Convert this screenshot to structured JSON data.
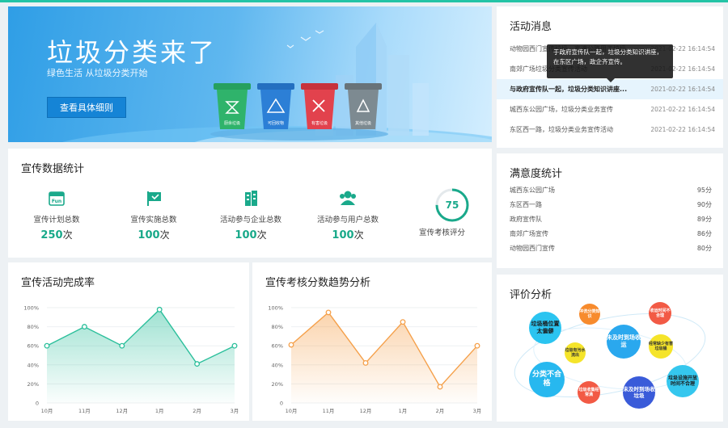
{
  "banner": {
    "headline": "垃圾分类来了",
    "sub": "绿色生活 从垃圾分类开始",
    "button": "查看具体细则",
    "bins": [
      {
        "label": "厨余垃圾",
        "color": "#2fb36b"
      },
      {
        "label": "可回收物",
        "color": "#2c7fd6"
      },
      {
        "label": "有害垃圾",
        "color": "#e2424d"
      },
      {
        "label": "其他垃圾",
        "color": "#7d8a91"
      }
    ]
  },
  "messages": {
    "title": "活动消息",
    "tooltip": "于政府宣传队一起，垃圾分类知识讲座，在东区广场，政企齐宣传。",
    "rows": [
      {
        "text": "动物园西门宣传垃圾，高速公路用于垃圾",
        "date": "2021-02-22 16:14:54"
      },
      {
        "text": "南郊广场垃圾分类宣传活动",
        "date": "2021-02-22 16:14:54"
      },
      {
        "text": "与政府宣传队一起，垃圾分类知识讲座...",
        "date": "2021-02-22 16:14:54"
      },
      {
        "text": "城西东公园广场，垃圾分类业务宣传",
        "date": "2021-02-22 16:14:54"
      },
      {
        "text": "东区西一路，垃圾分类业务宣传活动",
        "date": "2021-02-22 16:14:54"
      }
    ]
  },
  "stats": {
    "title": "宣传数据统计",
    "items": [
      {
        "label": "宣传计划总数",
        "value": "250",
        "unit": "次"
      },
      {
        "label": "宣传实施总数",
        "value": "100",
        "unit": "次"
      },
      {
        "label": "活动参与企业总数",
        "value": "100",
        "unit": "次"
      },
      {
        "label": "活动参与用户总数",
        "value": "100",
        "unit": "次"
      }
    ],
    "score": {
      "value": "75",
      "label": "宣传考核评分"
    }
  },
  "satisfaction": {
    "title": "满意度统计",
    "rows": [
      {
        "name": "城西东公园广场",
        "score": "95分"
      },
      {
        "name": "东区西一路",
        "score": "90分"
      },
      {
        "name": "政府宣传队",
        "score": "89分"
      },
      {
        "name": "南郊广场宣传",
        "score": "86分"
      },
      {
        "name": "动物园西门宣传",
        "score": "80分"
      }
    ]
  },
  "chart_data": [
    {
      "type": "area",
      "title": "宣传活动完成率",
      "categories": [
        "10月",
        "11月",
        "12月",
        "1月",
        "2月",
        "3月"
      ],
      "values": [
        60,
        80,
        60,
        98,
        41,
        60
      ],
      "yticks": [
        "0",
        "20%",
        "40%",
        "60%",
        "80%",
        "100%"
      ],
      "ylim": [
        0,
        100
      ],
      "color": "#2bbf9b"
    },
    {
      "type": "area",
      "title": "宣传考核分数趋势分析",
      "categories": [
        "10月",
        "11月",
        "12月",
        "1月",
        "2月",
        "3月"
      ],
      "values": [
        61,
        95,
        42,
        85,
        17,
        60
      ],
      "yticks": [
        "0",
        "20%",
        "40%",
        "60%",
        "80%",
        "100%"
      ],
      "ylim": [
        0,
        100
      ],
      "color": "#f5a04a"
    }
  ],
  "evaluation": {
    "title": "评价分析",
    "bubbles": [
      {
        "text": "垃圾桶位置太偏僻",
        "color": "#2bc4f0"
      },
      {
        "text": "冲洗分类知识",
        "color": "#f78b2d"
      },
      {
        "text": "收运时间不合理",
        "color": "#f25a45"
      },
      {
        "text": "未及时到场收运",
        "color": "#2aa8ee"
      },
      {
        "text": "垃圾有污水流出",
        "color": "#f5e42a"
      },
      {
        "text": "经常缺少有害垃圾桶",
        "color": "#f5e42a"
      },
      {
        "text": "分类不合格",
        "color": "#27b8ef"
      },
      {
        "text": "垃圾收集经常满",
        "color": "#f25a45"
      },
      {
        "text": "未及时到场收垃圾",
        "color": "#3a5bd9"
      },
      {
        "text": "垃圾设施开放时间不合理",
        "color": "#35c7ee"
      }
    ]
  }
}
